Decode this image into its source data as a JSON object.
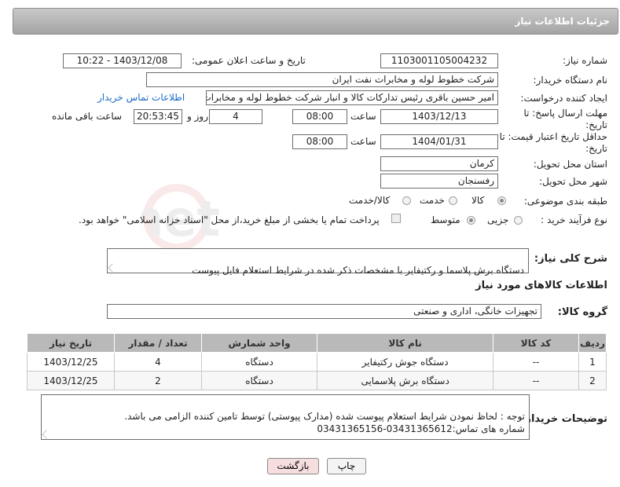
{
  "header": {
    "title": "جزئیات اطلاعات نیاز"
  },
  "watermark": {
    "text": "AriaTender.net"
  },
  "fields": {
    "need_number_label": "شماره نیاز:",
    "need_number": "1103001105004232",
    "announce_label": "تاریخ و ساعت اعلان عمومی:",
    "announce_value": "1403/12/08 - 10:22",
    "buyer_label": "نام دستگاه خریدار:",
    "buyer_value": "شرکت خطوط لوله و مخابرات نفت ایران",
    "requester_label": "ایجاد کننده درخواست:",
    "requester_value": "امیر حسین  باقری  رئیس تدارکات کالا و انبار  شرکت خطوط لوله و مخابرات نفت",
    "contact_link": "اطلاعات تماس خریدار",
    "deadline_label_1": "مهلت ارسال پاسخ: تا",
    "deadline_label_2": "تاریخ:",
    "deadline_date": "1403/12/13",
    "time_label": "ساعت",
    "deadline_time": "08:00",
    "days_value": "4",
    "days_label": "روز و",
    "remaining_time": "20:53:45",
    "remaining_label": "ساعت باقی مانده",
    "validity_label_1": "حداقل تاریخ اعتبار قیمت: تا",
    "validity_label_2": "تاریخ:",
    "validity_date": "1404/01/31",
    "validity_time_label": "ساعت",
    "validity_time": "08:00",
    "province_label": "استان محل تحویل:",
    "province_value": "کرمان",
    "city_label": "شهر محل تحویل:",
    "city_value": "رفسنجان",
    "category_label": "طبقه بندی موضوعی:",
    "category_options": [
      "کالا",
      "خدمت",
      "کالا/خدمت"
    ],
    "process_label": "نوع فرآیند خرید :",
    "process_options": [
      "جزیی",
      "متوسط"
    ],
    "payment_note": "پرداخت تمام یا بخشی از مبلغ خرید،از محل \"اسناد خزانه اسلامی\" خواهد بود.",
    "description_label": "شرح کلی نیاز:",
    "description_value": "دستگاه برش پلاسما  و رکتیفایر با مشخصات ذکر شده در شرایط استعلام فایل پیوست"
  },
  "goods": {
    "section_title": "اطلاعات کالاهای مورد نیاز",
    "group_label": "گروه کالا:",
    "group_value": "تجهیزات خانگی، اداری و صنعتی",
    "columns": [
      "ردیف",
      "کد کالا",
      "نام کالا",
      "واحد شمارش",
      "تعداد / مقدار",
      "تاریخ نیاز"
    ],
    "rows": [
      [
        "1",
        "--",
        "دستگاه جوش رکتیفایر",
        "دستگاه",
        "4",
        "1403/12/25"
      ],
      [
        "2",
        "--",
        "دستگاه برش پلاسمایی",
        "دستگاه",
        "2",
        "1403/12/25"
      ]
    ]
  },
  "notes": {
    "label": "توضیحات خریدار:",
    "value": "توجه : لحاظ نمودن شرایط استعلام پیوست شده (مدارک پیوستی) توسط تامین کننده الزامی می باشد.\nشماره های تماس:03431365612-03431365156"
  },
  "buttons": {
    "print": "چاپ",
    "back": "بازگشت"
  }
}
